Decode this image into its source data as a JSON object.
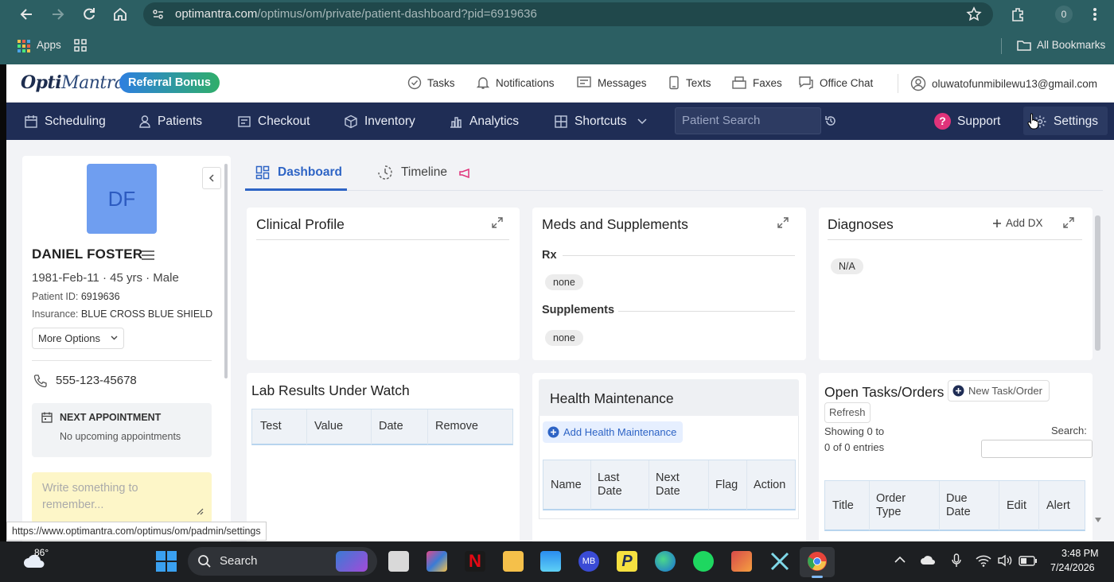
{
  "browser": {
    "url_host": "optimantra.com",
    "url_path": "/optimus/om/private/patient-dashboard?pid=6919636",
    "apps_label": "Apps",
    "all_bookmarks": "All Bookmarks",
    "profile_badge": "0"
  },
  "app": {
    "logo_text_a": "Opti",
    "logo_text_b": "Mantra",
    "referral_button": "Referral Bonus",
    "header_links": [
      "Tasks",
      "Notifications",
      "Messages",
      "Texts",
      "Faxes",
      "Office Chat"
    ],
    "user_email": "oluwatofunmibilewu13@gmail.com"
  },
  "nav": {
    "items": [
      "Scheduling",
      "Patients",
      "Checkout",
      "Inventory",
      "Analytics",
      "Shortcuts"
    ],
    "search_placeholder": "Patient Search",
    "support": "Support",
    "settings": "Settings"
  },
  "patient": {
    "initials": "DF",
    "name": "DANIEL FOSTER",
    "dob_line": "1981-Feb-11 · 45 yrs · Male",
    "id_label": "Patient ID:",
    "id_value": "6919636",
    "insurance_label": "Insurance:",
    "insurance_value": "BLUE CROSS BLUE SHIELD",
    "more_options": "More Options",
    "phone": "555-123-45678",
    "next_appt_title": "NEXT APPOINTMENT",
    "next_appt_value": "No upcoming appointments",
    "note_placeholder": "Write something to remember..."
  },
  "tabs": {
    "dashboard": "Dashboard",
    "timeline": "Timeline"
  },
  "clinical_profile": {
    "title": "Clinical Profile"
  },
  "meds": {
    "title": "Meds and Supplements",
    "rx_label": "Rx",
    "rx_value": "none",
    "supp_label": "Supplements",
    "supp_value": "none"
  },
  "diagnoses": {
    "title": "Diagnoses",
    "add_label": "Add DX",
    "value": "N/A"
  },
  "lab_results": {
    "title": "Lab Results Under Watch",
    "columns": [
      "Test",
      "Value",
      "Date",
      "Remove"
    ]
  },
  "health_maintenance": {
    "title": "Health Maintenance",
    "add_button": "Add Health Maintenance",
    "columns": [
      "Name",
      "Last Date",
      "Next Date",
      "Flag",
      "Action"
    ]
  },
  "open_tasks": {
    "title": "Open Tasks/Orders",
    "new_button": "New Task/Order",
    "refresh": "Refresh",
    "showing": "Showing 0 to 0 of 0 entries",
    "search_label": "Search:",
    "columns": [
      "Title",
      "Order Type",
      "Due Date",
      "Edit",
      "Alert"
    ]
  },
  "status_url": "https://www.optimantra.com/optimus/om/padmin/settings",
  "taskbar": {
    "weather": "86°",
    "search": "Search",
    "time": "3:48 PM",
    "date": "7/24/2026"
  }
}
